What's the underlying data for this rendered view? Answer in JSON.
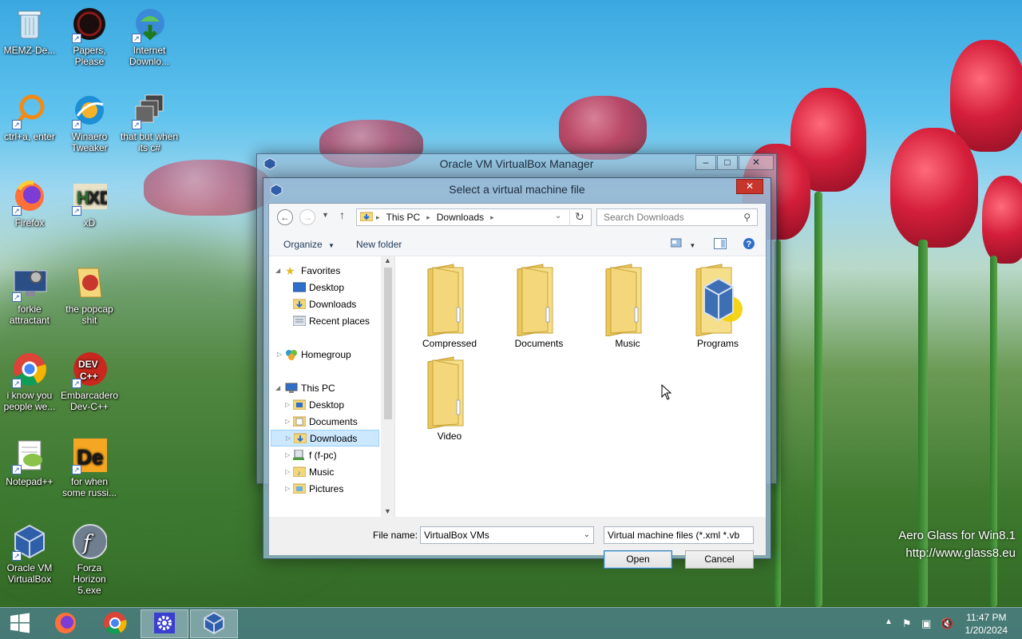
{
  "desktop": {
    "icons": [
      {
        "label": "MEMZ-De...",
        "icon": "recycle-bin-icon"
      },
      {
        "label": "Papers, Please",
        "icon": "papers-please-icon"
      },
      {
        "label": "Internet Downlo...",
        "icon": "internet-download-icon"
      },
      {
        "label": "ctrl+a, enter",
        "icon": "search-ring-icon"
      },
      {
        "label": "Winaero Tweaker",
        "icon": "winaero-icon"
      },
      {
        "label": "that but when its c#",
        "icon": "stack-windows-icon"
      },
      {
        "label": "Firefox",
        "icon": "firefox-icon"
      },
      {
        "label": "xD",
        "icon": "hxd-icon"
      },
      {
        "label": "forkie attractant",
        "icon": "monitor-gear-icon"
      },
      {
        "label": "the popcap shit",
        "icon": "popcap-icon"
      },
      {
        "label": "i know you people we...",
        "icon": "chrome-icon"
      },
      {
        "label": "Embarcadero Dev-C++",
        "icon": "devcpp-icon"
      },
      {
        "label": "Notepad++",
        "icon": "notepadpp-icon"
      },
      {
        "label": "for when some russi...",
        "icon": "de-icon"
      },
      {
        "label": "Oracle VM VirtualBox",
        "icon": "virtualbox-icon"
      },
      {
        "label": "Forza Horizon 5.exe",
        "icon": "flash-icon"
      }
    ]
  },
  "manager_window": {
    "title": "Oracle VM VirtualBox Manager",
    "minimize": "–",
    "maximize": "□",
    "close": "✕"
  },
  "dialog": {
    "title": "Select a virtual machine file",
    "close": "✕",
    "address": {
      "crumbs": [
        "This PC",
        "Downloads"
      ],
      "search_placeholder": "Search Downloads"
    },
    "toolbar": {
      "organize": "Organize",
      "new_folder": "New folder"
    },
    "nav": {
      "favorites": "Favorites",
      "fav_items": [
        "Desktop",
        "Downloads",
        "Recent places"
      ],
      "homegroup": "Homegroup",
      "this_pc": "This PC",
      "pc_items": [
        "Desktop",
        "Documents",
        "Downloads",
        "f (f-pc)",
        "Music",
        "Pictures"
      ]
    },
    "folders": [
      "Compressed",
      "Documents",
      "Music",
      "Programs",
      "Video"
    ],
    "file_name_label": "File name:",
    "file_name_value": "VirtualBox VMs",
    "file_type_value": "Virtual machine files (*.xml *.vb",
    "open": "Open",
    "cancel": "Cancel"
  },
  "taskbar": {
    "time": "11:47 PM",
    "date": "1/20/2024"
  },
  "watermark": {
    "line1": "Aero Glass for Win8.1",
    "line2": "http://www.glass8.eu"
  },
  "colors": {
    "folder_yellow": "#f3d77a",
    "selection": "#cce8ff",
    "close_red": "#c7352b"
  }
}
